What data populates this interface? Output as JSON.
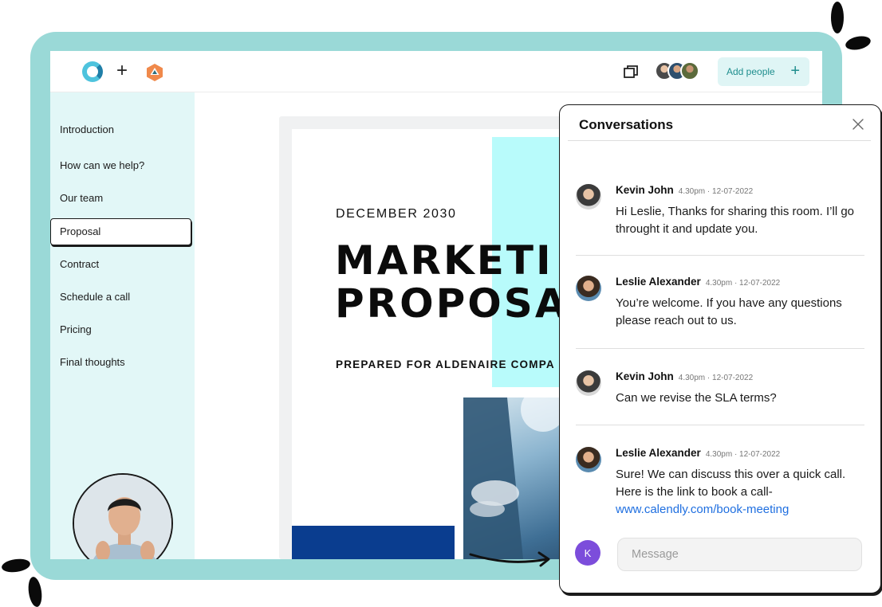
{
  "toolbar": {
    "add_people_label": "Add people",
    "add_people_plus": "+",
    "plus_glyph": "+"
  },
  "sidebar": {
    "items": [
      {
        "label": "Introduction"
      },
      {
        "label": "How can we help?"
      },
      {
        "label": "Our team"
      },
      {
        "label": "Proposal",
        "active": true
      },
      {
        "label": "Contract"
      },
      {
        "label": "Schedule a call"
      },
      {
        "label": "Pricing"
      },
      {
        "label": "Final thoughts"
      }
    ]
  },
  "document": {
    "date": "DECEMBER 2030",
    "title_line1": "MARKETI",
    "title_line2": "PROPOSA",
    "prepared_for": "PREPARED FOR ALDENAIRE COMPA"
  },
  "conversations": {
    "title": "Conversations",
    "messages": [
      {
        "author": "Kevin John",
        "time": "4.30pm · 12-07-2022",
        "text": "Hi Leslie, Thanks for sharing this room. I’ll go throught it and update you."
      },
      {
        "author": "Leslie Alexander",
        "time": "4.30pm · 12-07-2022",
        "text": "You’re welcome. If you have any questions please reach out to us."
      },
      {
        "author": "Kevin John",
        "time": "4.30pm · 12-07-2022",
        "text": "Can we revise the SLA terms?"
      },
      {
        "author": "Leslie Alexander",
        "time": "4.30pm · 12-07-2022",
        "text": "Sure! We can discuss this over a quick call. Here is the link to book a call-",
        "link": "www.calendly.com/book-meeting"
      }
    ],
    "composer": {
      "avatar_initial": "K",
      "placeholder": "Message"
    }
  },
  "colors": {
    "frame": "#9ad9d7",
    "sidebar_bg": "#e2f7f7",
    "doc_accent": "#b8fbfb",
    "doc_blue": "#0a3d8f",
    "link": "#1f6fe0",
    "user_avatar": "#7c4ddb"
  },
  "icons": [
    "app-logo-icon",
    "plus-icon",
    "hexagon-logo-icon",
    "chat-icon",
    "close-icon",
    "arrow-icon"
  ]
}
